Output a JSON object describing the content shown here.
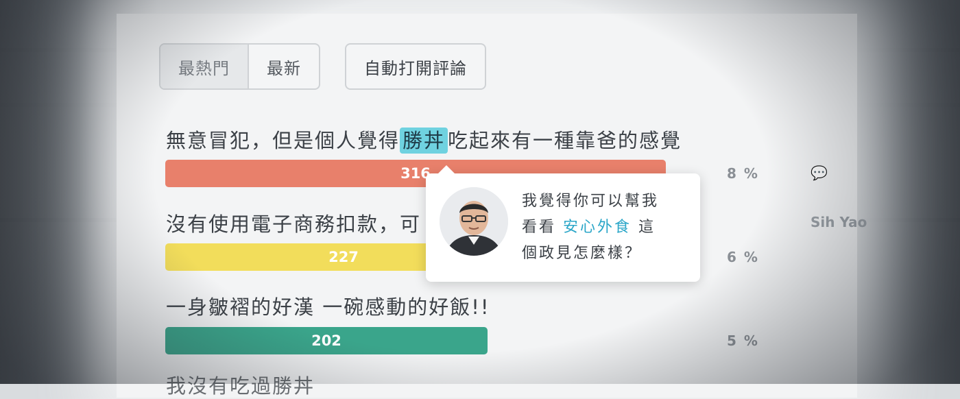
{
  "tabs": {
    "hot_label": "最熱門",
    "latest_label": "最新",
    "auto_open_label": "自動打開評論"
  },
  "items": [
    {
      "text_before": "無意冒犯，但是個人覺得",
      "highlight": "勝丼",
      "text_after": "吃起來有一種靠爸的感覺",
      "count": "316",
      "percent": "8 %",
      "share": 0.73,
      "color": "#e8806b"
    },
    {
      "text_before": "沒有使用電子商務扣款，可",
      "highlight": "",
      "text_after": "",
      "count": "227",
      "percent": "6 %",
      "share": 0.52,
      "color": "#f2dd5b"
    },
    {
      "text_before": "一身皺褶的好漢 一碗感動的好飯!!",
      "highlight": "",
      "text_after": "",
      "count": "202",
      "percent": "5 %",
      "share": 0.47,
      "color": "#3aa58b"
    }
  ],
  "tooltip": {
    "line1": "我覺得你可以幫我",
    "line2_before": "看看",
    "line2_highlight": "安心外食",
    "line2_after": "這",
    "line3": "個政見怎麼樣？"
  },
  "side": {
    "author": "Sih Yao"
  },
  "bottom_partial": "我沒有吃過勝丼"
}
